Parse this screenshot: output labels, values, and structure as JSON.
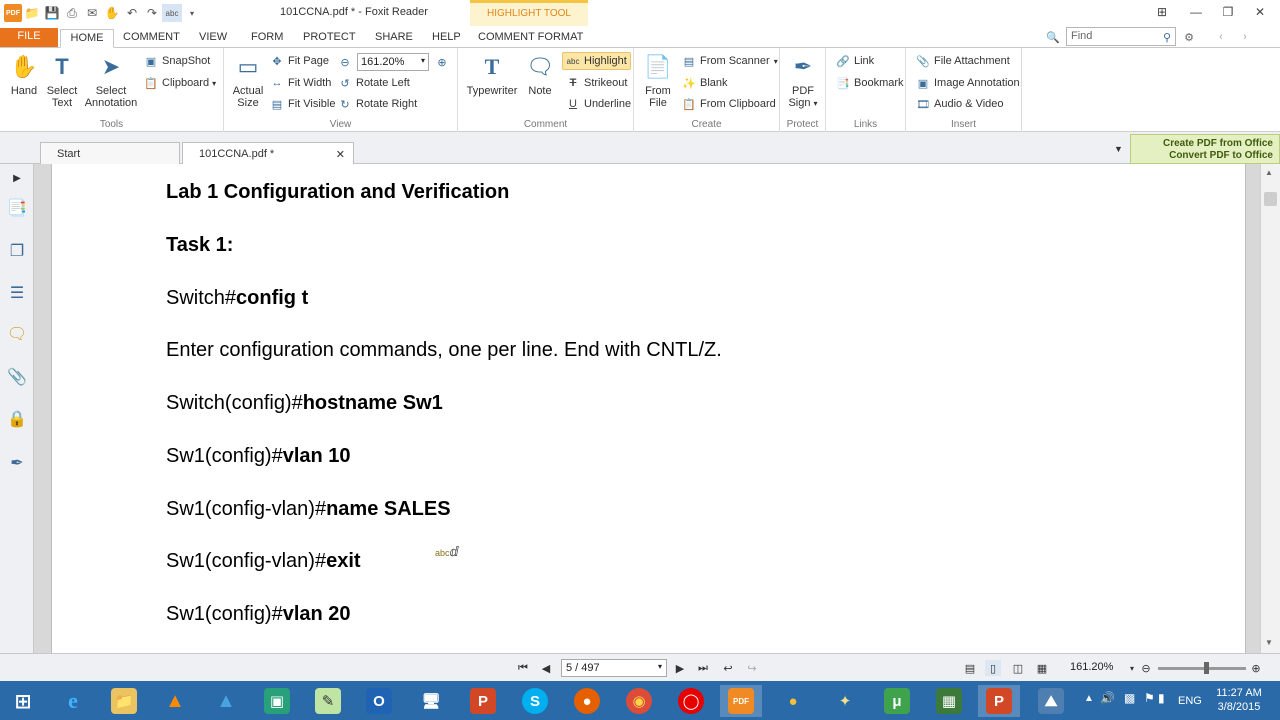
{
  "window": {
    "title": "101CCNA.pdf * - Foxit Reader",
    "context_tool": "HIGHLIGHT TOOL",
    "app_logo": "PDF"
  },
  "ribbon_tabs": [
    "FILE",
    "HOME",
    "COMMENT",
    "VIEW",
    "FORM",
    "PROTECT",
    "SHARE",
    "HELP",
    "COMMENT FORMAT"
  ],
  "find_placeholder": "Find",
  "groups": {
    "tools": {
      "label": "Tools",
      "hand": "Hand",
      "select_text_1": "Select",
      "select_text_2": "Text",
      "select_annot_1": "Select",
      "select_annot_2": "Annotation",
      "snapshot": "SnapShot",
      "clipboard": "Clipboard"
    },
    "view": {
      "label": "View",
      "actual_1": "Actual",
      "actual_2": "Size",
      "fit_page": "Fit Page",
      "fit_width": "Fit Width",
      "fit_visible": "Fit Visible",
      "zoom": "161.20%",
      "rotate_left": "Rotate Left",
      "rotate_right": "Rotate Right"
    },
    "comment": {
      "label": "Comment",
      "typewriter": "Typewriter",
      "note": "Note",
      "highlight": "Highlight",
      "strikeout": "Strikeout",
      "underline": "Underline"
    },
    "create": {
      "label": "Create",
      "from_file_1": "From",
      "from_file_2": "File",
      "from_scanner": "From Scanner",
      "blank": "Blank",
      "from_clipboard": "From Clipboard"
    },
    "protect": {
      "label": "Protect",
      "pdf_sign_1": "PDF",
      "pdf_sign_2": "Sign"
    },
    "links": {
      "label": "Links",
      "link": "Link",
      "bookmark": "Bookmark"
    },
    "insert": {
      "label": "Insert",
      "file_attachment": "File Attachment",
      "image_annotation": "Image Annotation",
      "audio_video": "Audio & Video"
    }
  },
  "doc_tabs": {
    "start": "Start",
    "doc": "101CCNA.pdf *"
  },
  "promo": {
    "line1": "Create PDF from Office",
    "line2": "Convert PDF to Office"
  },
  "document": {
    "title": "Lab 1 Configuration and Verification",
    "task": "Task 1:",
    "lines": [
      {
        "prompt": "Switch#",
        "cmd": "config t"
      },
      {
        "prompt": "Enter configuration commands, one per line.  End with CNTL/Z.",
        "cmd": ""
      },
      {
        "prompt": "Switch(config)#",
        "cmd": "hostname Sw1"
      },
      {
        "prompt": "Sw1(config)#",
        "cmd": "vlan 10"
      },
      {
        "prompt": "Sw1(config-vlan)#",
        "cmd": "name SALES"
      },
      {
        "prompt": "Sw1(config-vlan)#",
        "cmd": "exit"
      },
      {
        "prompt": "Sw1(config)#",
        "cmd": "vlan 20"
      }
    ],
    "cursor_label": "abc"
  },
  "status": {
    "page": "5 / 497",
    "zoom": "161.20%"
  },
  "taskbar": {
    "lang": "ENG",
    "time": "11:27 AM",
    "date": "3/8/2015"
  }
}
